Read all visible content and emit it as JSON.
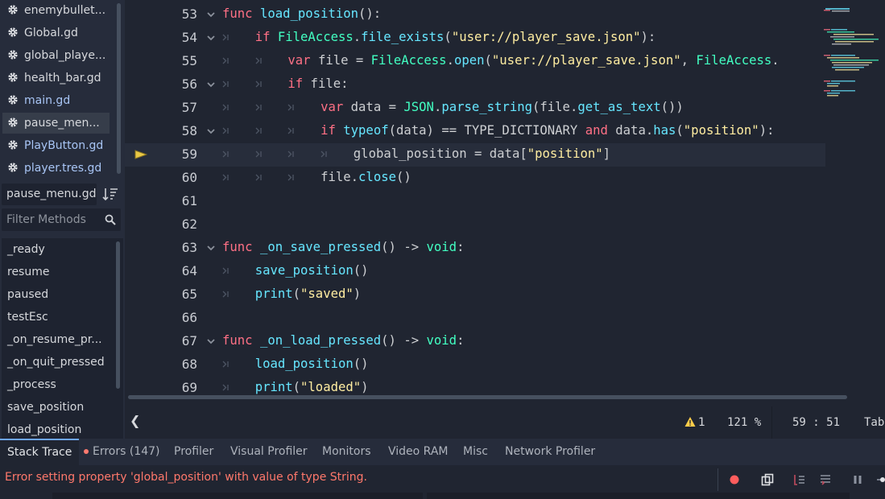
{
  "file_list": [
    {
      "name": "enemybullet...",
      "color": "normal"
    },
    {
      "name": "Global.gd",
      "color": "normal"
    },
    {
      "name": "global_playe...",
      "color": "normal"
    },
    {
      "name": "health_bar.gd",
      "color": "normal"
    },
    {
      "name": "main.gd",
      "color": "blue"
    },
    {
      "name": "pause_men...",
      "color": "normal",
      "selected": true
    },
    {
      "name": "PlayButton.gd",
      "color": "blue"
    },
    {
      "name": "player.tres.gd",
      "color": "blue"
    }
  ],
  "current_script": "pause_menu.gd",
  "filter_methods_placeholder": "Filter Methods",
  "methods": [
    "_ready",
    "resume",
    "paused",
    "testEsc",
    "_on_resume_pr...",
    "_on_quit_pressed",
    "_process",
    "save_position",
    "load_position"
  ],
  "editor": {
    "current_line": 59,
    "lines": [
      {
        "n": "53",
        "fold": true,
        "indent": 0,
        "tokens": [
          [
            "kw",
            "func"
          ],
          [
            "cm",
            " "
          ],
          [
            "fn",
            "load_position"
          ],
          [
            "cm",
            "():"
          ]
        ]
      },
      {
        "n": "54",
        "fold": true,
        "indent": 1,
        "tokens": [
          [
            "kw",
            "if"
          ],
          [
            "cm",
            " "
          ],
          [
            "cl",
            "FileAccess"
          ],
          [
            "cm",
            "."
          ],
          [
            "fn",
            "file_exists"
          ],
          [
            "cm",
            "("
          ],
          [
            "st",
            "\"user://player_save.json\""
          ],
          [
            "cm",
            "):"
          ]
        ]
      },
      {
        "n": "55",
        "fold": false,
        "indent": 2,
        "tokens": [
          [
            "kw",
            "var"
          ],
          [
            "cm",
            " file = "
          ],
          [
            "cl",
            "FileAccess"
          ],
          [
            "cm",
            "."
          ],
          [
            "fn",
            "open"
          ],
          [
            "cm",
            "("
          ],
          [
            "st",
            "\"user://player_save.json\""
          ],
          [
            "cm",
            ", "
          ],
          [
            "cl",
            "FileAccess"
          ],
          [
            "cm",
            "."
          ]
        ]
      },
      {
        "n": "56",
        "fold": true,
        "indent": 2,
        "tokens": [
          [
            "kw",
            "if"
          ],
          [
            "cm",
            " file:"
          ]
        ]
      },
      {
        "n": "57",
        "fold": false,
        "indent": 3,
        "tokens": [
          [
            "kw",
            "var"
          ],
          [
            "cm",
            " data = "
          ],
          [
            "cl",
            "JSON"
          ],
          [
            "cm",
            "."
          ],
          [
            "fn",
            "parse_string"
          ],
          [
            "cm",
            "(file."
          ],
          [
            "fn",
            "get_as_text"
          ],
          [
            "cm",
            "())"
          ]
        ]
      },
      {
        "n": "58",
        "fold": true,
        "indent": 3,
        "tokens": [
          [
            "kw",
            "if"
          ],
          [
            "cm",
            " "
          ],
          [
            "fn",
            "typeof"
          ],
          [
            "cm",
            "(data) == TYPE_DICTIONARY "
          ],
          [
            "kw",
            "and"
          ],
          [
            "cm",
            " data."
          ],
          [
            "fn",
            "has"
          ],
          [
            "cm",
            "("
          ],
          [
            "st",
            "\"position\""
          ],
          [
            "cm",
            "):"
          ]
        ]
      },
      {
        "n": "59",
        "fold": false,
        "indent": 4,
        "tokens": [
          [
            "cm",
            "global_position = data["
          ],
          [
            "st",
            "\"position\""
          ],
          [
            "cm",
            "]"
          ]
        ]
      },
      {
        "n": "60",
        "fold": false,
        "indent": 3,
        "tokens": [
          [
            "cm",
            "file."
          ],
          [
            "fn",
            "close"
          ],
          [
            "cm",
            "()"
          ]
        ]
      },
      {
        "n": "61",
        "fold": false,
        "indent": 0,
        "tokens": []
      },
      {
        "n": "62",
        "fold": false,
        "indent": 0,
        "tokens": []
      },
      {
        "n": "63",
        "fold": true,
        "indent": 0,
        "tokens": [
          [
            "kw",
            "func"
          ],
          [
            "cm",
            " "
          ],
          [
            "fn",
            "_on_save_pressed"
          ],
          [
            "cm",
            "() -> "
          ],
          [
            "cl",
            "void"
          ],
          [
            "cm",
            ":"
          ]
        ]
      },
      {
        "n": "64",
        "fold": false,
        "indent": 1,
        "tokens": [
          [
            "fn",
            "save_position"
          ],
          [
            "cm",
            "()"
          ]
        ]
      },
      {
        "n": "65",
        "fold": false,
        "indent": 1,
        "tokens": [
          [
            "fn",
            "print"
          ],
          [
            "cm",
            "("
          ],
          [
            "st",
            "\"saved\""
          ],
          [
            "cm",
            ")"
          ]
        ]
      },
      {
        "n": "66",
        "fold": false,
        "indent": 0,
        "tokens": []
      },
      {
        "n": "67",
        "fold": true,
        "indent": 0,
        "tokens": [
          [
            "kw",
            "func"
          ],
          [
            "cm",
            " "
          ],
          [
            "fn",
            "_on_load_pressed"
          ],
          [
            "cm",
            "() -> "
          ],
          [
            "cl",
            "void"
          ],
          [
            "cm",
            ":"
          ]
        ]
      },
      {
        "n": "68",
        "fold": false,
        "indent": 1,
        "tokens": [
          [
            "fn",
            "load_position"
          ],
          [
            "cm",
            "()"
          ]
        ]
      },
      {
        "n": "69",
        "fold": false,
        "indent": 1,
        "tokens": [
          [
            "fn",
            "print"
          ],
          [
            "cm",
            "("
          ],
          [
            "st",
            "\"loaded\""
          ],
          [
            "cm",
            ")"
          ]
        ]
      }
    ]
  },
  "status": {
    "back_glyph": "❮",
    "warnings": "1",
    "zoom": "121 %",
    "position": "59 :  51",
    "indent_mode": "Tabs"
  },
  "bottom_tabs": [
    {
      "label": "Stack Trace",
      "active": true
    },
    {
      "label": "Errors (147)",
      "dot": true
    },
    {
      "label": "Profiler"
    },
    {
      "label": "Visual Profiler"
    },
    {
      "label": "Monitors"
    },
    {
      "label": "Video RAM"
    },
    {
      "label": "Misc"
    },
    {
      "label": "Network Profiler"
    }
  ],
  "error_message": "Error setting property 'global_position' with value of type String.",
  "colors": {
    "keyword": "#ff7085",
    "function": "#66e6ff",
    "class": "#42ffc2",
    "string": "#ffeda1",
    "error": "#ff786b",
    "accent": "#6ea6ff"
  }
}
